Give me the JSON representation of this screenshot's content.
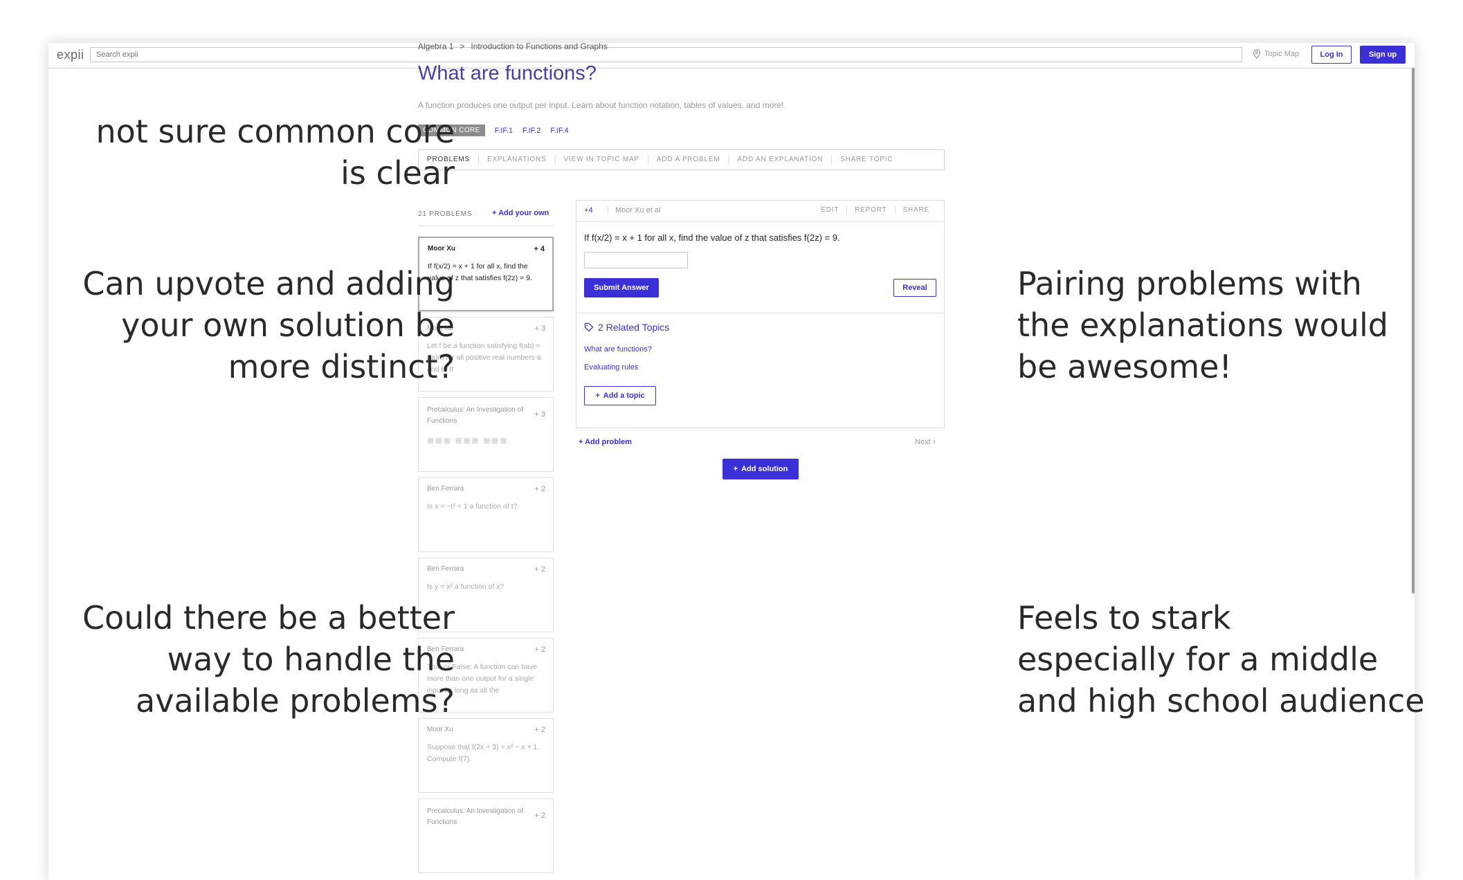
{
  "topbar": {
    "logo": "expii",
    "search_placeholder": "Search expii",
    "topic_map": "Topic Map",
    "login": "Log In",
    "signup": "Sign up"
  },
  "breadcrumb": [
    "Algebra 1",
    ">",
    "Introduction to Functions and Graphs"
  ],
  "page": {
    "title": "What are functions?",
    "subtitle": "A function produces one output per input. Learn about function notation, tables of values, and more!",
    "common_core": "COMMON CORE",
    "standards": [
      "F.IF.1",
      "F.IF.2",
      "F.IF.4"
    ]
  },
  "tabs": [
    "PROBLEMS",
    "EXPLANATIONS",
    "VIEW IN TOPIC MAP",
    "ADD A PROBLEM",
    "ADD AN EXPLANATION",
    "SHARE TOPIC"
  ],
  "problem_list": {
    "count": "21 PROBLEMS",
    "add_own": "Add your own",
    "items": [
      {
        "author": "Moor Xu",
        "votes": "+ 4",
        "text": "If f(x/2) = x + 1 for all x, find the value of z that satisfies f(2z) = 9."
      },
      {
        "author": "Moor Xu",
        "votes": "+ 3",
        "text": "Let f be a function satisfying f(ab) = f(a)/b for all positive real numbers a and b. If"
      },
      {
        "author": "Precalculus: An Investigation of Functions",
        "votes": "+ 3",
        "text": ""
      },
      {
        "author": "Ben Ferrara",
        "votes": "+ 2",
        "text": "Is s = −t² + 1 a function of t?"
      },
      {
        "author": "Ben Ferrara",
        "votes": "+ 2",
        "text": "Is y = x² a function of x?"
      },
      {
        "author": "Ben Ferrara",
        "votes": "+ 2",
        "text": "True or False: A function can have more than one output for a single input as long as all the"
      },
      {
        "author": "Moor Xu",
        "votes": "+ 2",
        "text": "Suppose that f(2x + 3) = x² − x + 1. Compute f(7)."
      },
      {
        "author": "Precalculus: An Investigation of Functions",
        "votes": "+ 2",
        "text": ""
      }
    ]
  },
  "detail": {
    "votes": "4",
    "author": "Moor Xu et al",
    "actions": [
      "EDIT",
      "REPORT",
      "SHARE"
    ],
    "question": "If f(x/2) = x + 1 for all x, find the value of z that satisfies f(2z) = 9.",
    "submit": "Submit Answer",
    "reveal": "Reveal",
    "related_title": "2 Related Topics",
    "related_topics": [
      "What are functions?",
      "Evaluating rules"
    ],
    "add_topic": "Add a topic",
    "add_problem": "Add problem",
    "next": "Next",
    "add_solution": "Add solution"
  },
  "notes": {
    "common_core": "not sure common core\nis clear",
    "upvote": "Can upvote and adding\nyour own solution be\nmore distinct?",
    "problems": "Could there be a better\nway to handle the\navailable problems?",
    "pairing": "Pairing problems with\nthe explanations would\nbe awesome!",
    "stark": "Feels to stark\nespecially for a middle\nand high school audience"
  },
  "colors": {
    "accent": "#3b2fd8",
    "title": "#4a3ea6",
    "badge": "#8c8c8c"
  }
}
